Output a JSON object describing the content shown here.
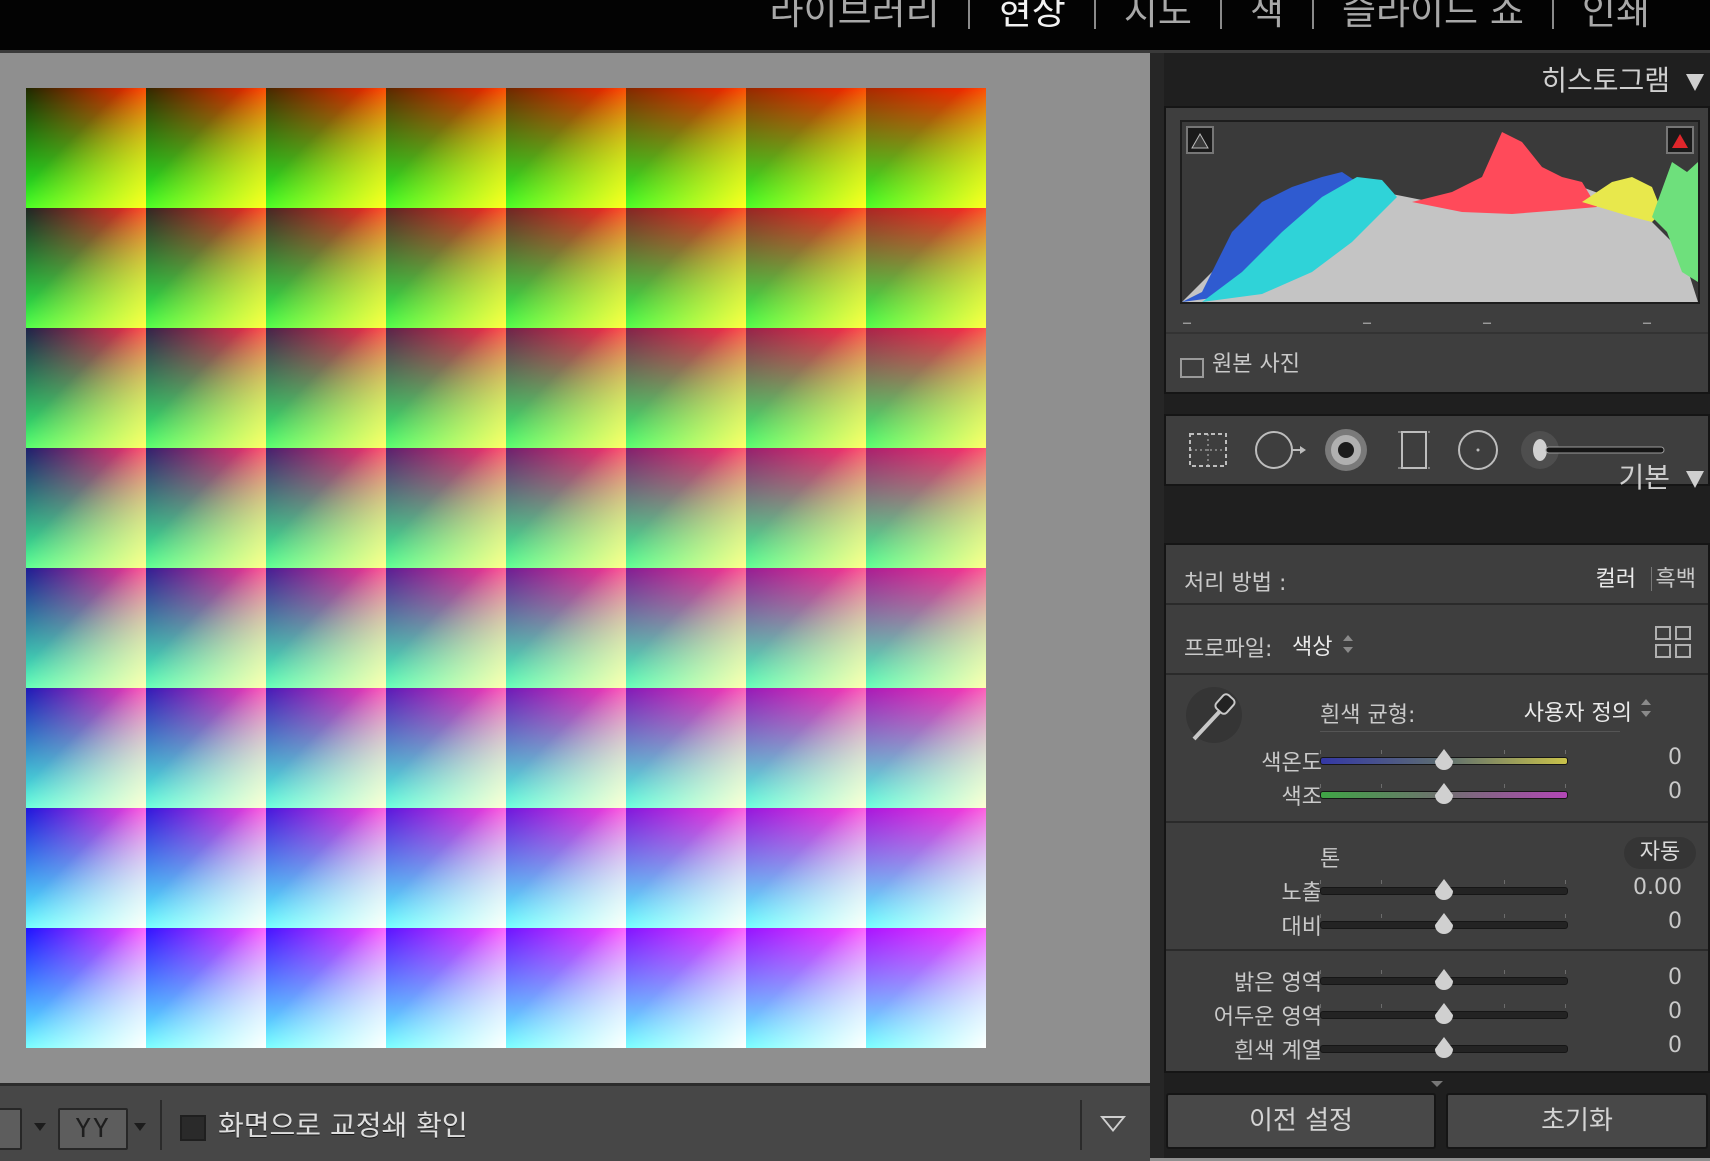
{
  "topbar": {
    "modules": [
      {
        "label": "라이브러리",
        "active": false
      },
      {
        "label": "현상",
        "active": true
      },
      {
        "label": "지도",
        "active": false
      },
      {
        "label": "책",
        "active": false
      },
      {
        "label": "슬라이드 쇼",
        "active": false
      },
      {
        "label": "인쇄",
        "active": false
      }
    ]
  },
  "bottombar": {
    "view_mode_label": "YY",
    "softproof_label": "화면으로 교정쇄 확인"
  },
  "histogram": {
    "title": "히스토그램",
    "original_photo_label": "원본 사진",
    "tick_labels": [
      "–",
      "–",
      "–",
      "–"
    ],
    "colors": {
      "blue": "#2f5bd0",
      "cyan": "#2fd3d8",
      "red": "#ff4a5a",
      "yellow": "#e8e84c",
      "green": "#6ee07c",
      "gray": "#c4c4c4"
    }
  },
  "tools": [
    "crop-overlay-icon",
    "spot-removal-icon",
    "red-eye-icon",
    "graduated-filter-icon",
    "radial-filter-icon",
    "adjustment-brush-icon"
  ],
  "basic": {
    "title": "기본",
    "treatment_label": "처리 방법 :",
    "treatment_color": "컬러",
    "treatment_bw": "흑백",
    "profile_label": "프로파일:",
    "profile_value": "색상",
    "wb_label": "흰색 균형:",
    "wb_value": "사용자 정의",
    "tone_label": "톤",
    "auto_label": "자동",
    "sliders": {
      "temp": {
        "label": "색온도",
        "value": "0"
      },
      "tint": {
        "label": "색조",
        "value": "0"
      },
      "exposure": {
        "label": "노출",
        "value": "0.00"
      },
      "contrast": {
        "label": "대비",
        "value": "0"
      },
      "highlights": {
        "label": "밝은 영역",
        "value": "0"
      },
      "shadows": {
        "label": "어두운 영역",
        "value": "0"
      },
      "whites": {
        "label": "흰색 계열",
        "value": "0"
      }
    }
  },
  "footer": {
    "previous_label": "이전 설정",
    "reset_label": "초기화"
  }
}
